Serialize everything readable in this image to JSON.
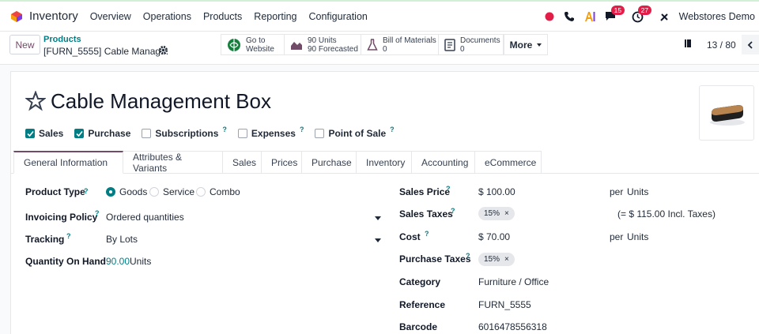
{
  "topbar": {
    "app_name": "Inventory",
    "menu": [
      "Overview",
      "Operations",
      "Products",
      "Reporting",
      "Configuration"
    ],
    "chat_badge": "15",
    "activity_badge": "27",
    "company": "Webstores Demo"
  },
  "control": {
    "new_label": "New",
    "breadcrumb_parent": "Products",
    "breadcrumb_current": "[FURN_5555] Cable Manag...",
    "smart_buttons": {
      "website": {
        "l1": "Go to",
        "l2": "Website"
      },
      "units": {
        "l1": "90 Units",
        "l2": "90 Forecasted"
      },
      "bom": {
        "l1": "Bill of Materials",
        "l2": "0"
      },
      "documents": {
        "l1": "Documents",
        "l2": "0"
      }
    },
    "more_label": "More",
    "pager": "13 / 80"
  },
  "product": {
    "name": "Cable Management Box",
    "flags": {
      "sales": "Sales",
      "purchase": "Purchase",
      "subscriptions": "Subscriptions",
      "expenses": "Expenses",
      "pos": "Point of Sale",
      "help": "?"
    },
    "tabs": [
      "General Information",
      "Attributes & Variants",
      "Sales",
      "Prices",
      "Purchase",
      "Inventory",
      "Accounting",
      "eCommerce"
    ]
  },
  "fields": {
    "product_type_label": "Product Type",
    "type_options": {
      "goods": "Goods",
      "service": "Service",
      "combo": "Combo"
    },
    "invoicing_label": "Invoicing Policy",
    "invoicing_value": "Ordered quantities",
    "tracking_label": "Tracking",
    "tracking_value": "By Lots",
    "qoh_label": "Quantity On Hand",
    "qoh_value": "90.00",
    "qoh_unit": "Units",
    "sales_price_label": "Sales Price",
    "sales_price_value": "$ 100.00",
    "sales_price_per": "per",
    "sales_price_uom": "Units",
    "sales_taxes_label": "Sales Taxes",
    "sales_tax_tag": "15%",
    "incl_taxes": "(= $ 115.00 Incl. Taxes)",
    "cost_label": "Cost",
    "cost_value": "$ 70.00",
    "cost_per": "per",
    "cost_uom": "Units",
    "purchase_taxes_label": "Purchase Taxes",
    "purchase_tax_tag": "15%",
    "category_label": "Category",
    "category_value": "Furniture / Office",
    "reference_label": "Reference",
    "reference_value": "FURN_5555",
    "barcode_label": "Barcode",
    "barcode_value": "6016478556318"
  }
}
